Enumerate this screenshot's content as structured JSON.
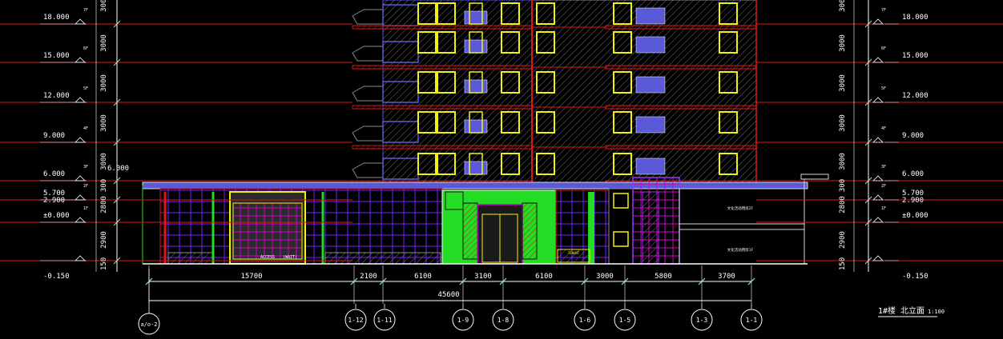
{
  "colors": {
    "background": "#000000",
    "level_line": "#e01616",
    "annotation": "#ffffff",
    "tick": "#7bf3ff",
    "window": "#f2f20e",
    "facade_blue": "#5a5ad8",
    "facade_purple": "#9b35ff",
    "facade_magenta": "#d000d0",
    "facade_green": "#23dc23",
    "hatch_gray": "#8a8a8a"
  },
  "elevation": {
    "left": [
      {
        "value": "18.000",
        "floor": "7F"
      },
      {
        "value": "15.000",
        "floor": "6F"
      },
      {
        "value": "12.000",
        "floor": "5F"
      },
      {
        "value": "9.000",
        "floor": "4F"
      },
      {
        "value": "6.000",
        "floor": "3F"
      },
      {
        "value": "5.700",
        "value2": "2.900",
        "floor": "2F"
      },
      {
        "value": "±0.000",
        "floor": "1F"
      },
      {
        "value": "-0.150"
      }
    ],
    "right": [
      {
        "value": "18.000",
        "floor": "7F"
      },
      {
        "value": "15.000",
        "floor": "6F"
      },
      {
        "value": "12.000",
        "floor": "5F"
      },
      {
        "value": "9.000",
        "floor": "4F"
      },
      {
        "value": "6.000",
        "floor": "3F"
      },
      {
        "value": "5.700",
        "value2": "2.900",
        "floor": "2F"
      },
      {
        "value": "±0.000",
        "floor": "1F"
      },
      {
        "value": "-0.150"
      }
    ],
    "mid_level_label": "6.000"
  },
  "storey_dims": [
    "3000",
    "3000",
    "3000",
    "3000",
    "3000",
    "300",
    "2800",
    "2900",
    "150"
  ],
  "bottom_dims": {
    "segments": [
      "15700",
      "2100",
      "6100",
      "3100",
      "6100",
      "3000",
      "5800",
      "3700"
    ],
    "total": "45600"
  },
  "axes": [
    "1-12",
    "1-11",
    "1-9",
    "1-8",
    "1-6",
    "1-5",
    "1-3",
    "1-1"
  ],
  "grid_ref": "a/o-2",
  "shop_labels": [
    "文化活动用房2F",
    "文化活动用房1F"
  ],
  "door_note_a": "ACCESS",
  "door_note_b": "(WAIT)",
  "sign_text": "TENANT",
  "drawing_title": "1#楼 北立面",
  "drawing_scale": "1:100"
}
